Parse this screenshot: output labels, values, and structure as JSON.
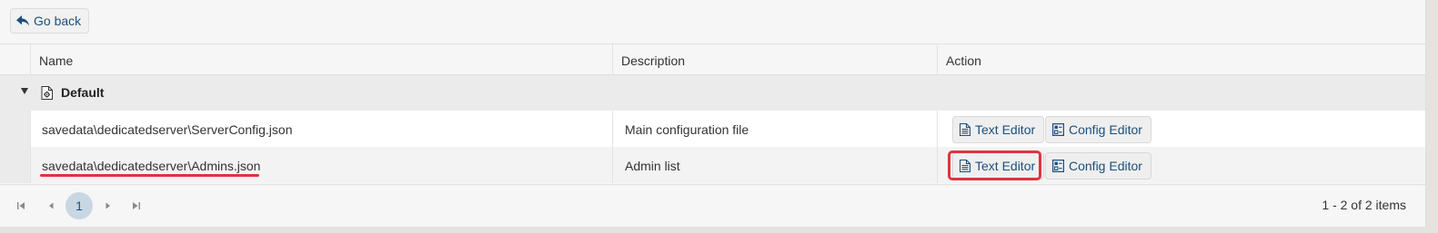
{
  "toolbar": {
    "back_label": "Go back",
    "back_icon": "arrow-back-icon"
  },
  "grid": {
    "columns": [
      {
        "label": "Name"
      },
      {
        "label": "Description"
      },
      {
        "label": "Action"
      }
    ],
    "group": {
      "label": "Default",
      "icon": "config-file-icon",
      "expanded": true
    },
    "rows": [
      {
        "name": "savedata\\dedicatedserver\\ServerConfig.json",
        "description": "Main configuration file",
        "actions": [
          {
            "label": "Text Editor",
            "icon": "document-icon"
          },
          {
            "label": "Config Editor",
            "icon": "config-form-icon"
          }
        ]
      },
      {
        "name": "savedata\\dedicatedserver\\Admins.json",
        "description": "Admin list",
        "actions": [
          {
            "label": "Text Editor",
            "icon": "document-icon"
          },
          {
            "label": "Config Editor",
            "icon": "config-form-icon"
          }
        ]
      }
    ]
  },
  "pager": {
    "current_page": "1",
    "info": "1 - 2 of 2 items"
  },
  "colors": {
    "accent": "#1d4f7a",
    "highlight": "#e0333d",
    "current_page_bg": "#c9d7e3"
  }
}
